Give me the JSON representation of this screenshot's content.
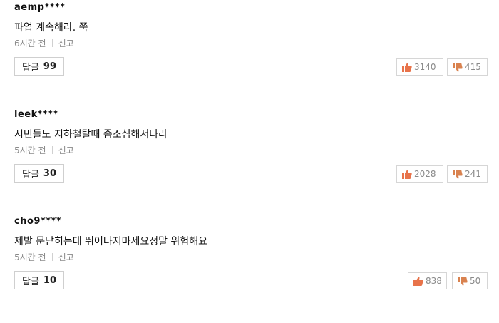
{
  "comments": [
    {
      "user": "aemp****",
      "text": "파업 계속해라. 쭉",
      "time": "6시간 전",
      "report": "신고",
      "reply_label": "답글",
      "reply_count": "99",
      "likes": "3140",
      "dislikes": "415"
    },
    {
      "user": "leek****",
      "text": "시민들도 지하철탈때 좀조심해서타라",
      "time": "5시간 전",
      "report": "신고",
      "reply_label": "답글",
      "reply_count": "30",
      "likes": "2028",
      "dislikes": "241"
    },
    {
      "user": "cho9****",
      "text": "제발 문닫히는데 뛰어타지마세요정말 위험해요",
      "time": "5시간 전",
      "report": "신고",
      "reply_label": "답글",
      "reply_count": "10",
      "likes": "838",
      "dislikes": "50"
    }
  ],
  "icons": {
    "like": "thumbs-up-icon",
    "dislike": "thumbs-down-icon"
  },
  "colors": {
    "like_icon": "#e8734a",
    "dislike_icon": "#d9824f",
    "meta_text": "#8a8a8a",
    "divider": "#e3e3e3"
  }
}
